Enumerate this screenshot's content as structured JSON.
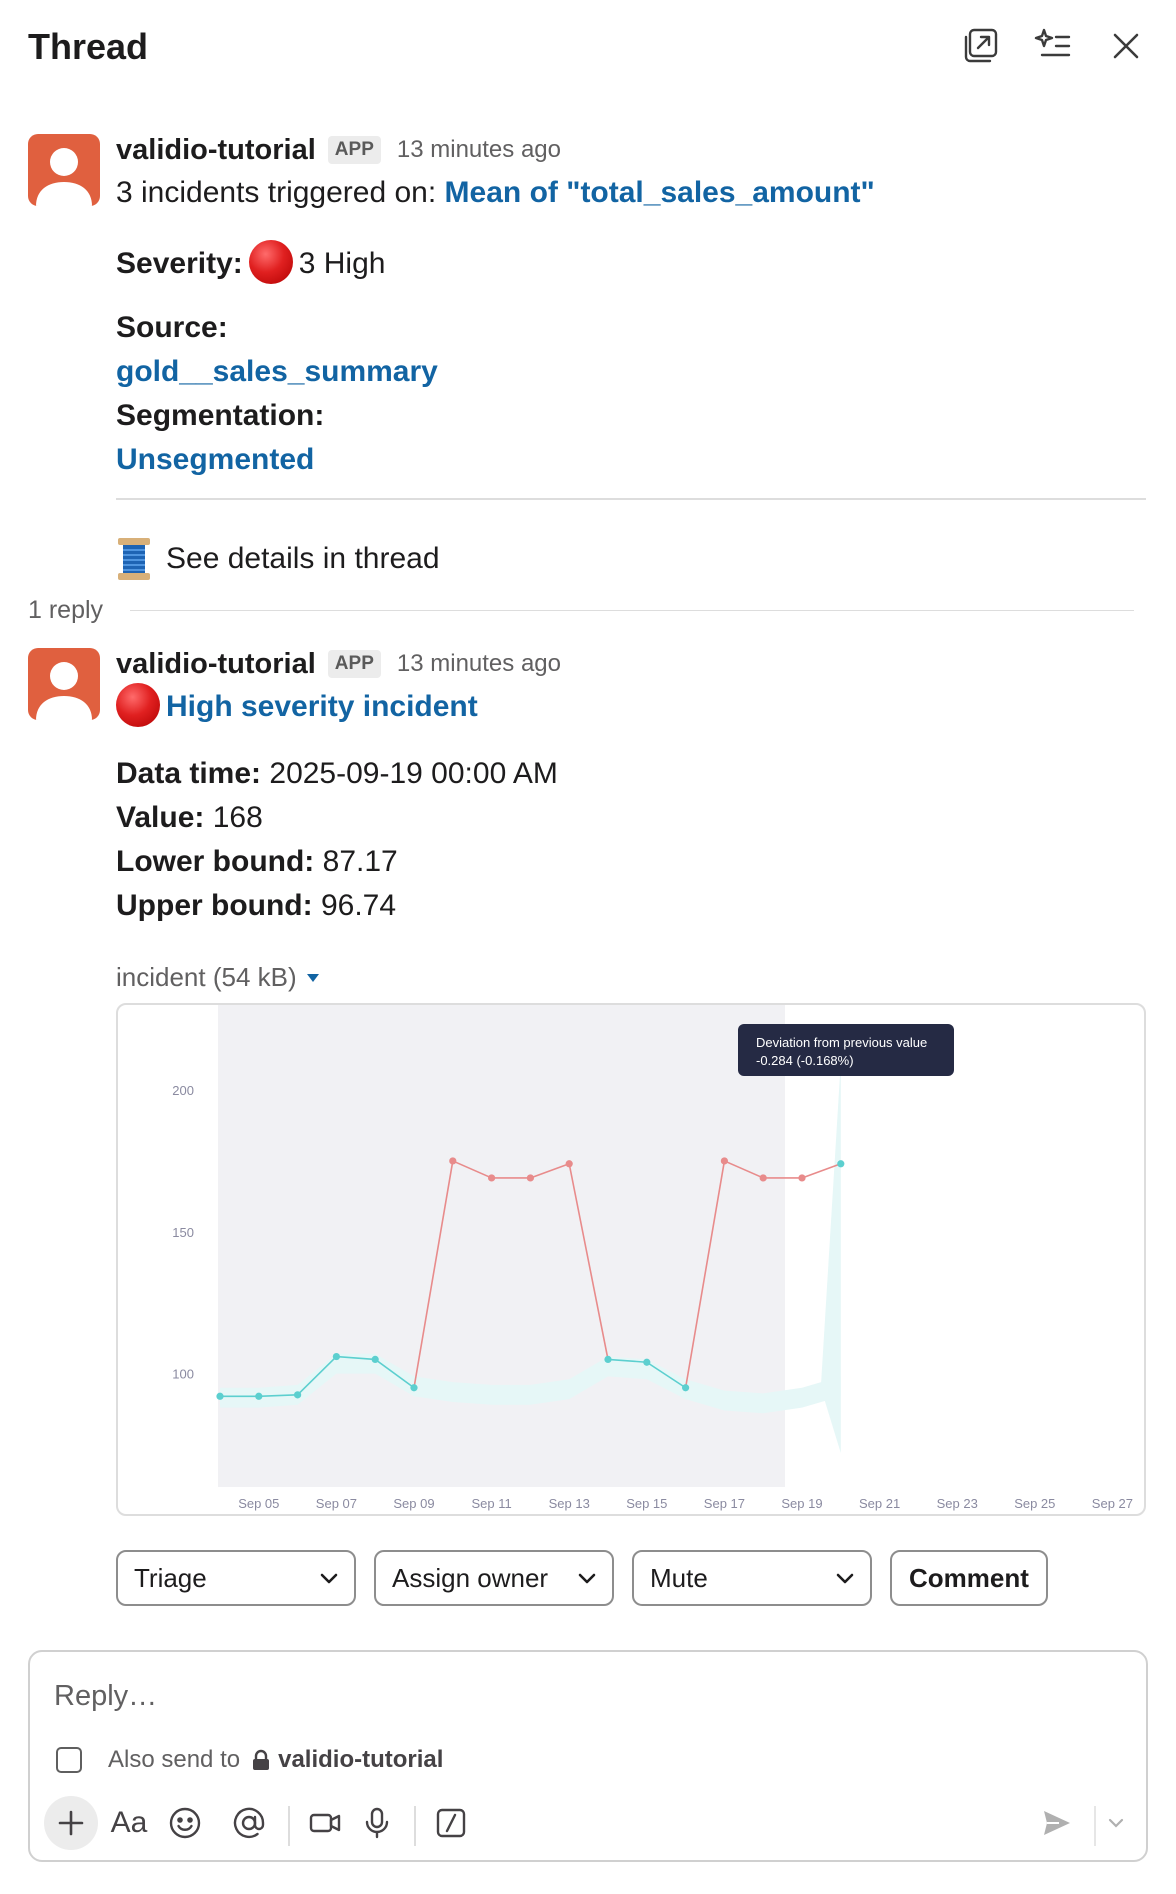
{
  "header": {
    "title": "Thread"
  },
  "parent_message": {
    "sender": "validio-tutorial",
    "badge": "APP",
    "time": "13 minutes ago",
    "summary_prefix": "3 incidents triggered on: ",
    "summary_link": "Mean of \"total_sales_amount\"",
    "severity_label": "Severity:",
    "severity_value": "3 High",
    "source_label": "Source:",
    "source_value": "gold__sales_summary",
    "segmentation_label": "Segmentation:",
    "segmentation_value": "Unsegmented",
    "thread_link": "See details in thread"
  },
  "reply_count": "1 reply",
  "reply_message": {
    "sender": "validio-tutorial",
    "badge": "APP",
    "time": "13 minutes ago",
    "title": "High severity incident",
    "fields": [
      {
        "label": "Data time:",
        "value": " 2025-09-19 00:00 AM"
      },
      {
        "label": "Value:",
        "value": " 168"
      },
      {
        "label": "Lower bound:",
        "value": " 87.17"
      },
      {
        "label": "Upper bound:",
        "value": " 96.74"
      }
    ],
    "file_label": "incident (54 kB)"
  },
  "chart_data": {
    "type": "line",
    "x": [
      "Sep 04",
      "Sep 05",
      "Sep 06",
      "Sep 07",
      "Sep 08",
      "Sep 09",
      "Sep 10",
      "Sep 11",
      "Sep 12",
      "Sep 13",
      "Sep 14",
      "Sep 15",
      "Sep 16",
      "Sep 17",
      "Sep 18",
      "Sep 19",
      "Sep 20"
    ],
    "values": [
      92,
      92,
      92.5,
      106,
      105,
      95,
      175,
      169,
      169,
      174,
      105,
      104,
      95,
      175,
      169,
      169,
      174
    ],
    "anomalous": [
      false,
      false,
      false,
      false,
      false,
      false,
      true,
      true,
      true,
      true,
      false,
      false,
      false,
      true,
      true,
      true,
      false
    ],
    "x_tick_labels": [
      "Sep 05",
      "Sep 07",
      "Sep 09",
      "Sep 11",
      "Sep 13",
      "Sep 15",
      "Sep 17",
      "Sep 19",
      "Sep 21",
      "Sep 23",
      "Sep 25",
      "Sep 27"
    ],
    "y_ticks": [
      100,
      150,
      200
    ],
    "ylim": [
      60,
      230
    ],
    "tooltip_title": "Deviation from previous value",
    "tooltip_value": "-0.284  (-0.168%)",
    "colors": {
      "normal": "#5ccfcf",
      "anomaly": "#e88b8b",
      "band": "#e6f7f7",
      "plot_bg": "#f1f1f4",
      "tooltip_bg": "#252a44"
    }
  },
  "actions": {
    "triage": "Triage",
    "assign_owner": "Assign owner",
    "mute": "Mute",
    "comment": "Comment"
  },
  "composer": {
    "placeholder": "Reply…",
    "also_send": "Also send to",
    "channel": "validio-tutorial",
    "format_label": "Aa"
  }
}
